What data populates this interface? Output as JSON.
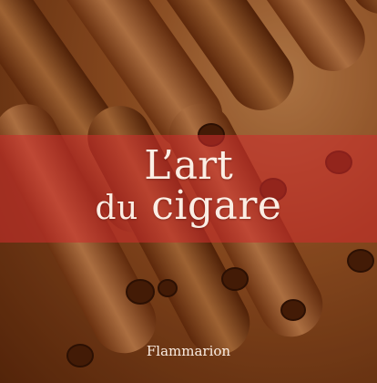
{
  "cover": {
    "title_line1": "L’art",
    "title_line2_word1": "du",
    "title_line2_word2": "cigare",
    "publisher": "Flammarion",
    "image": "cigars-photo",
    "colors": {
      "band": "#cd2d2d",
      "text": "#fbeee4",
      "background": "#7a3c14"
    }
  }
}
